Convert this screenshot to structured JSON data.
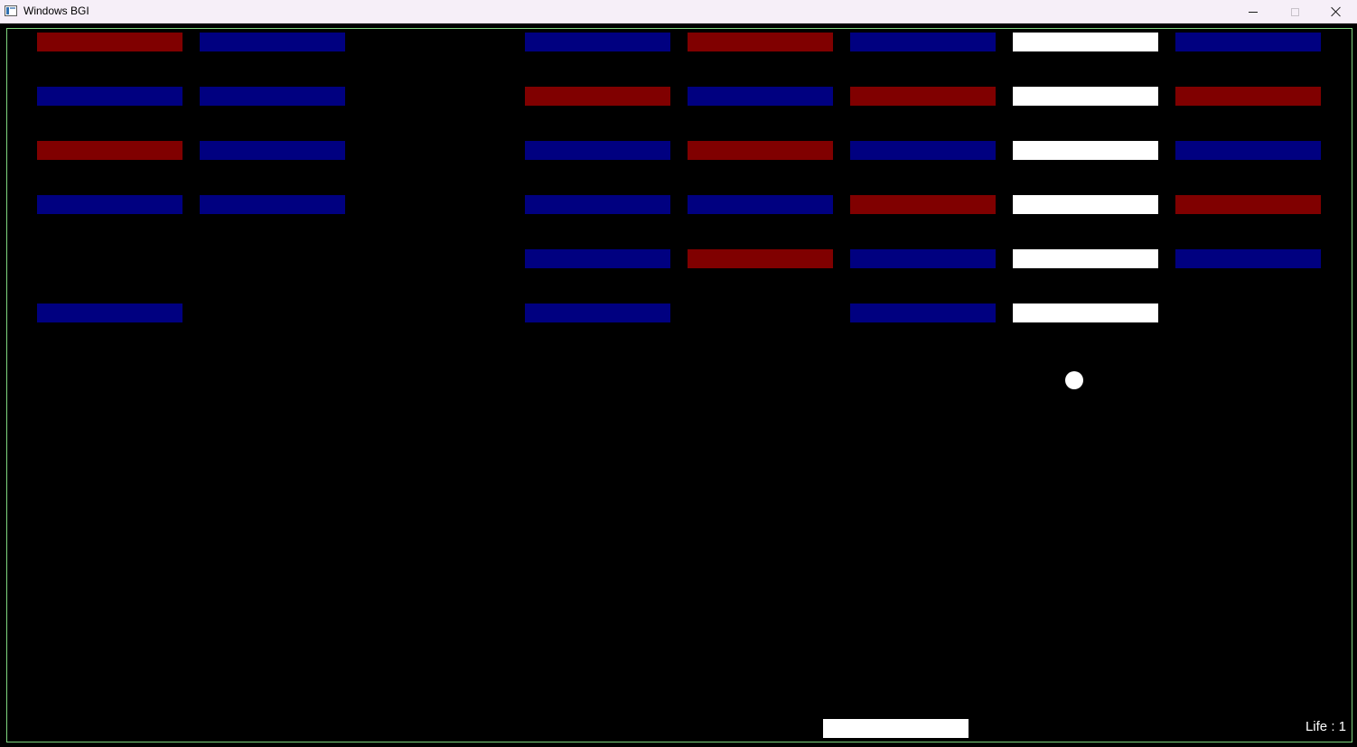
{
  "window": {
    "title": "Windows BGI",
    "icon": "app-window-icon",
    "controls": [
      "minimize",
      "maximize",
      "close"
    ]
  },
  "colors": {
    "background": "#000000",
    "border": "#7fd67f",
    "red": "#800000",
    "blue": "#000080",
    "white": "#ffffff",
    "ball": "#ffffff",
    "paddle": "#ffffff"
  },
  "bricks": [
    [
      "red",
      "blue",
      null,
      "blue",
      "red",
      "blue",
      "white",
      "blue"
    ],
    [
      "blue",
      "blue",
      null,
      "red",
      "blue",
      "red",
      "white",
      "red"
    ],
    [
      "red",
      "blue",
      null,
      "blue",
      "red",
      "blue",
      "white",
      "blue"
    ],
    [
      "blue",
      "blue",
      null,
      "blue",
      "blue",
      "red",
      "white",
      "red"
    ],
    [
      null,
      null,
      null,
      "blue",
      "red",
      "blue",
      "white",
      "blue"
    ],
    [
      "blue",
      null,
      null,
      "blue",
      null,
      "blue",
      "white",
      null
    ]
  ],
  "hud": {
    "life_text": "Life : 1",
    "lives": 1
  }
}
